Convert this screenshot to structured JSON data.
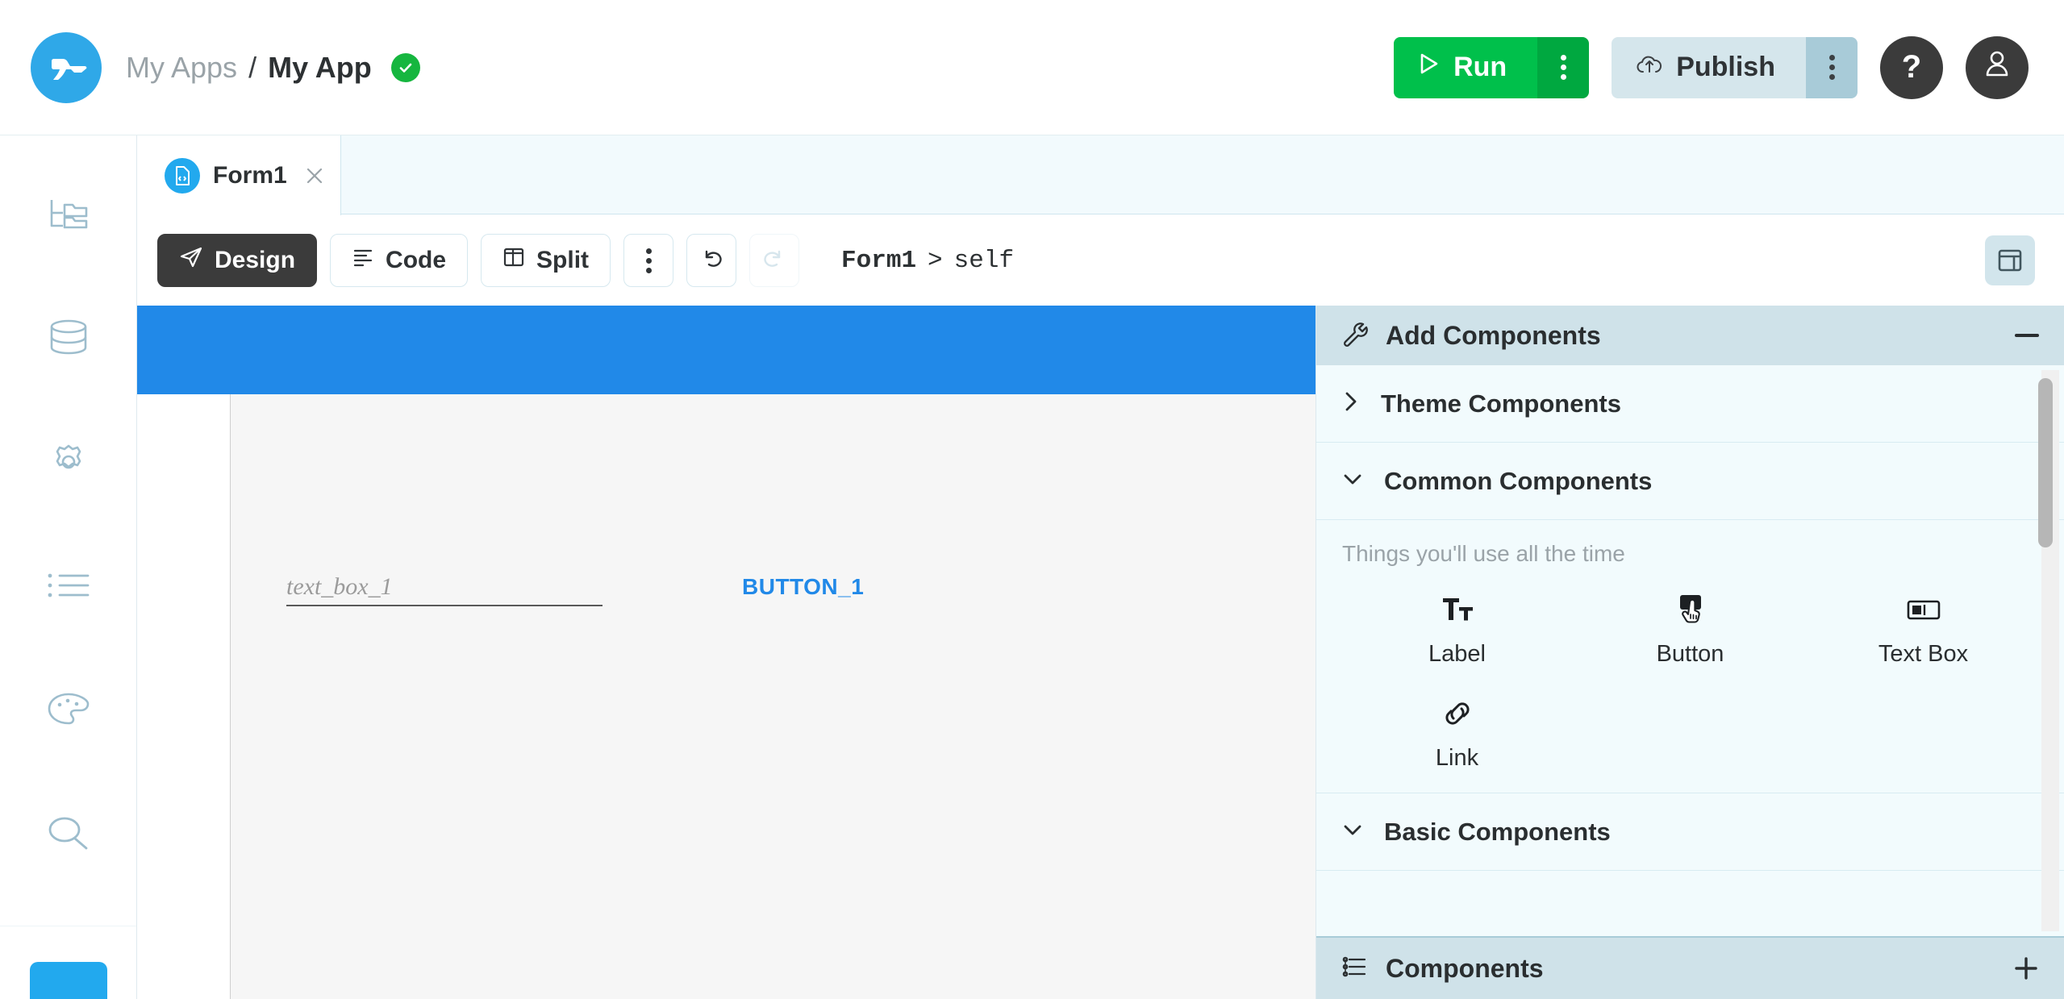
{
  "topbar": {
    "logo_icon": "anvil-logo-icon",
    "breadcrumb": {
      "parent": "My Apps",
      "separator": "/",
      "current": "My App",
      "status_icon": "check-circle-icon"
    },
    "run_button": {
      "label": "Run",
      "icon": "play-icon",
      "menu_icon": "kebab-menu-icon",
      "color": "#00c04b"
    },
    "publish_button": {
      "label": "Publish",
      "icon": "cloud-upload-icon",
      "menu_icon": "kebab-menu-icon",
      "color": "#d5e6ec"
    },
    "help_button": {
      "label": "?",
      "icon": "question-mark-icon"
    },
    "account_button": {
      "icon": "user-avatar-icon"
    }
  },
  "sidebar": {
    "items": [
      {
        "name": "app-browser",
        "icon": "file-tree-icon"
      },
      {
        "name": "data-tables",
        "icon": "database-icon"
      },
      {
        "name": "app-settings",
        "icon": "gear-icon"
      },
      {
        "name": "services",
        "icon": "list-icon"
      },
      {
        "name": "theme",
        "icon": "palette-icon"
      },
      {
        "name": "search",
        "icon": "search-icon"
      }
    ],
    "bottom_button": {
      "name": "new-item",
      "color": "#22a9ee"
    }
  },
  "tabs": [
    {
      "label": "Form1",
      "icon": "form-file-icon",
      "close_icon": "close-icon",
      "active": true
    }
  ],
  "toolbar": {
    "design_label": "Design",
    "design_icon": "cursor-arrow-icon",
    "code_label": "Code",
    "code_icon": "code-lines-icon",
    "split_label": "Split",
    "split_icon": "split-panes-icon",
    "more_icon": "kebab-menu-icon",
    "undo_icon": "undo-icon",
    "redo_icon": "redo-icon",
    "breadcrumb_form": "Form1",
    "breadcrumb_sep": ">",
    "breadcrumb_target": "self",
    "panel_toggle_icon": "layout-panel-icon"
  },
  "canvas": {
    "header_color": "#2189e8",
    "text_box": {
      "placeholder": "text_box_1",
      "name": "text_box_1"
    },
    "button": {
      "label": "BUTTON_1",
      "color": "#2189e8"
    }
  },
  "right_panel": {
    "header": {
      "title": "Add Components",
      "icon": "wrench-icon",
      "collapse_icon": "minus-icon"
    },
    "sections": [
      {
        "label": "Theme Components",
        "chevron": "chevron-right-icon",
        "expanded": false
      },
      {
        "label": "Common Components",
        "chevron": "chevron-down-icon",
        "expanded": true
      }
    ],
    "common_hint": "Things you'll use all the time",
    "common_components": [
      {
        "label": "Label",
        "icon": "text-format-icon"
      },
      {
        "label": "Button",
        "icon": "button-cursor-icon"
      },
      {
        "label": "Text Box",
        "icon": "textbox-icon"
      },
      {
        "label": "Link",
        "icon": "link-chain-icon"
      }
    ],
    "basic_section": {
      "label": "Basic Components",
      "chevron": "chevron-down-icon"
    },
    "footer": {
      "title": "Components",
      "icon": "component-tree-icon",
      "add_icon": "plus-icon"
    }
  }
}
